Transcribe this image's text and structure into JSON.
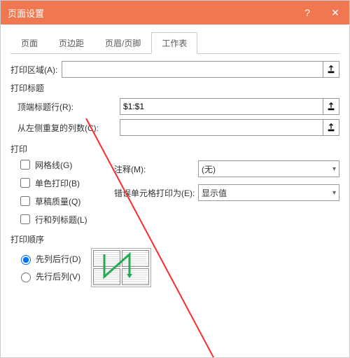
{
  "window": {
    "title": "页面设置",
    "help": "?",
    "close": "✕"
  },
  "tabs": {
    "page": "页面",
    "margins": "页边距",
    "header_footer": "页眉/页脚",
    "sheet": "工作表"
  },
  "print_area": {
    "label": "打印区域(A):",
    "value": ""
  },
  "titles": {
    "group": "打印标题",
    "rows_label": "顶端标题行(R):",
    "rows_value": "$1:$1",
    "cols_label": "从左侧重复的列数(C):",
    "cols_value": ""
  },
  "print": {
    "group": "打印",
    "gridlines": "网格线(G)",
    "bw": "单色打印(B)",
    "draft": "草稿质量(Q)",
    "rowcol_headings": "行和列标题(L)",
    "comments_label": "注释(M):",
    "comments_value": "(无)",
    "errors_label": "错误单元格打印为(E):",
    "errors_value": "显示值"
  },
  "order": {
    "group": "打印顺序",
    "down_over": "先列后行(D)",
    "over_down": "先行后列(V)"
  }
}
